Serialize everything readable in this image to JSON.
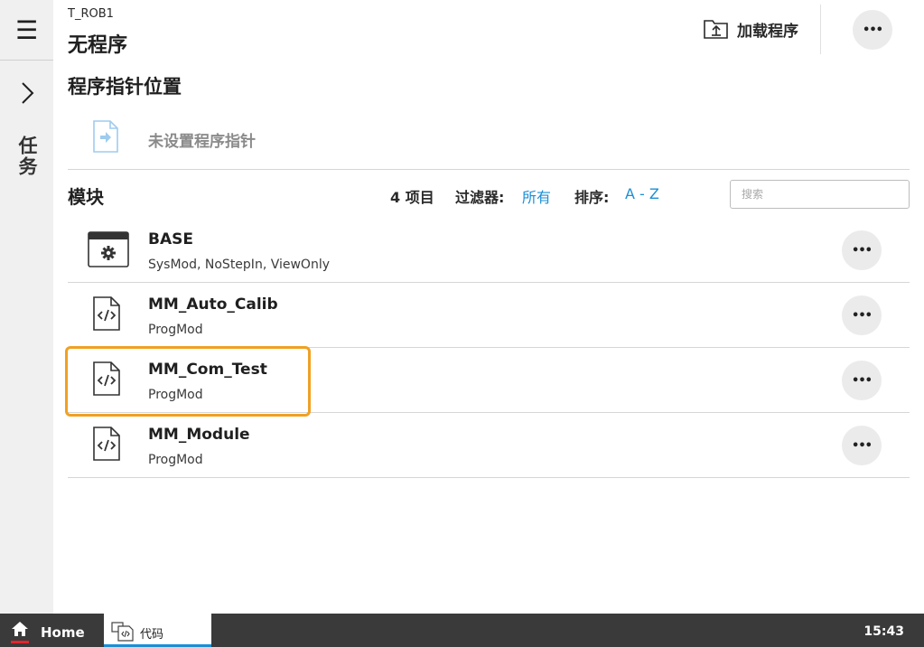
{
  "header": {
    "task_name": "T_ROB1",
    "program_status": "无程序",
    "load_label": "加载程序"
  },
  "rail": {
    "menu_glyph": "☰",
    "vertical_label": "任务"
  },
  "pointer_section": {
    "title": "程序指针位置",
    "status": "未设置程序指针"
  },
  "modules": {
    "title": "模块",
    "count": "4 项目",
    "filter_label": "过滤器:",
    "filter_value": "所有",
    "sort_label": "排序:",
    "sort_value": "A - Z",
    "search_placeholder": "搜索",
    "items": [
      {
        "name": "BASE",
        "type": "SysMod, NoStepIn, ViewOnly",
        "icon": "system-module-icon"
      },
      {
        "name": "MM_Auto_Calib",
        "type": "ProgMod",
        "icon": "code-file-icon"
      },
      {
        "name": "MM_Com_Test",
        "type": "ProgMod",
        "icon": "code-file-icon",
        "highlighted": true
      },
      {
        "name": "MM_Module",
        "type": "ProgMod",
        "icon": "code-file-icon"
      }
    ]
  },
  "more_glyph": "•••",
  "taskbar": {
    "home_label": "Home",
    "code_tab_label": "代码",
    "time": "15:43"
  },
  "colors": {
    "accent": "#1a8fd6",
    "highlight": "#f0a023",
    "home_indicator": "#e4242c",
    "taskbar": "#3a3a3a",
    "rail": "#f0f0f0"
  }
}
